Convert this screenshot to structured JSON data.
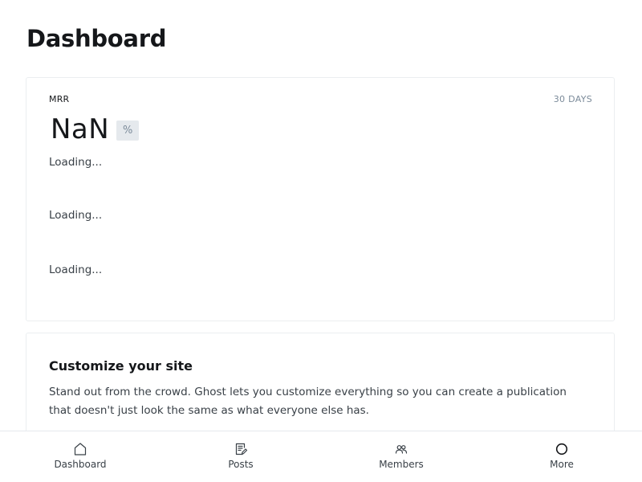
{
  "page": {
    "title": "Dashboard"
  },
  "mrr_card": {
    "label": "MRR",
    "period": "30 DAYS",
    "value": "NaN",
    "badge": "%",
    "loading_texts": [
      "Loading...",
      "Loading...",
      "Loading..."
    ]
  },
  "customize_card": {
    "title": "Customize your site",
    "description": "Stand out from the crowd. Ghost lets you customize everything so you can create a publication that doesn't just look the same as what everyone else has."
  },
  "bottom_nav": {
    "items": [
      {
        "label": "Dashboard",
        "icon": "home-icon"
      },
      {
        "label": "Posts",
        "icon": "posts-icon"
      },
      {
        "label": "Members",
        "icon": "members-icon"
      },
      {
        "label": "More",
        "icon": "circle-icon"
      }
    ]
  },
  "colors": {
    "text": "#15171a",
    "muted": "#7c8b9a",
    "border": "#ebeef0",
    "badge_bg": "#e5e9ed"
  }
}
